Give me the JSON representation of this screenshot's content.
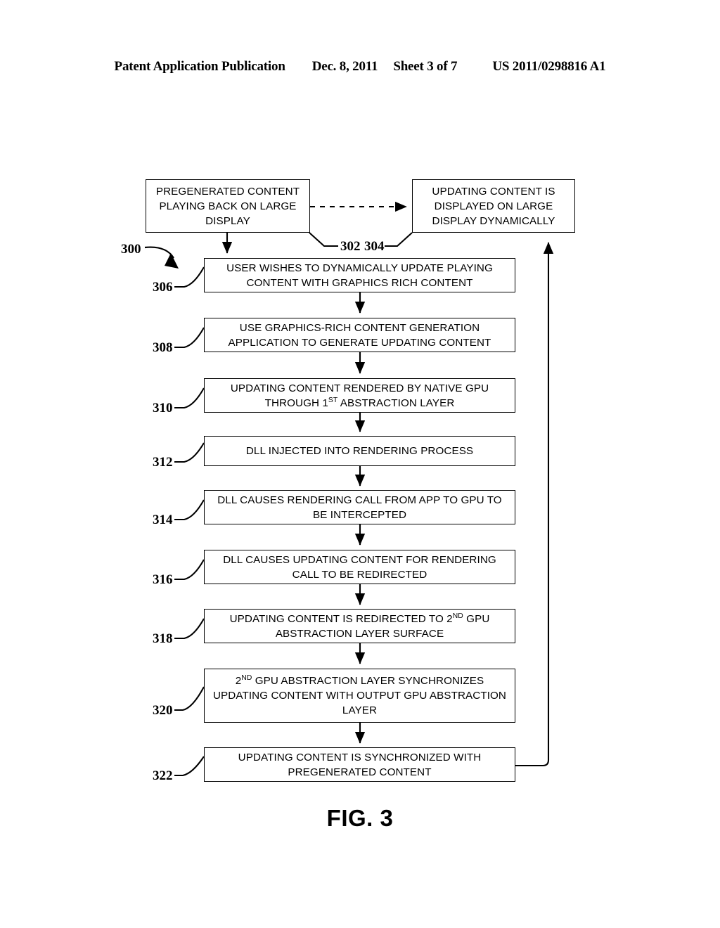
{
  "header": {
    "publication": "Patent Application Publication",
    "date": "Dec. 8, 2011",
    "sheet": "Sheet 3 of 7",
    "number": "US 2011/0298816 A1"
  },
  "figure": {
    "caption": "FIG. 3",
    "diagram_ref": "300"
  },
  "flowchart": {
    "nodes": [
      {
        "ref": "302",
        "name": "pregenerated-content-box",
        "lines": [
          "PREGENERATED CONTENT",
          "PLAYING BACK ON LARGE",
          "DISPLAY"
        ],
        "text": "PREGENERATED CONTENT PLAYING BACK ON LARGE DISPLAY"
      },
      {
        "ref": "304",
        "name": "updating-content-displayed-box",
        "lines": [
          "UPDATING CONTENT IS",
          "DISPLAYED ON LARGE",
          "DISPLAY DYNAMICALLY"
        ],
        "text": "UPDATING CONTENT IS DISPLAYED ON LARGE DISPLAY DYNAMICALLY"
      },
      {
        "ref": "306",
        "name": "user-wishes-update-box",
        "lines": [
          "USER WISHES TO DYNAMICALLY UPDATE PLAYING",
          "CONTENT WITH GRAPHICS RICH CONTENT"
        ],
        "text": "USER WISHES TO DYNAMICALLY UPDATE PLAYING CONTENT WITH GRAPHICS RICH CONTENT"
      },
      {
        "ref": "308",
        "name": "use-graphics-rich-application-box",
        "lines": [
          "USE GRAPHICS-RICH CONTENT GENERATION",
          "APPLICATION TO GENERATE UPDATING CONTENT"
        ],
        "text": "USE GRAPHICS-RICH CONTENT GENERATION APPLICATION TO GENERATE UPDATING CONTENT"
      },
      {
        "ref": "310",
        "name": "rendered-by-native-gpu-box",
        "lines": [
          "UPDATING CONTENT RENDERED BY NATIVE GPU",
          "THROUGH 1ST ABSTRACTION LAYER"
        ],
        "text": "UPDATING CONTENT RENDERED BY NATIVE GPU THROUGH 1ST ABSTRACTION LAYER"
      },
      {
        "ref": "312",
        "name": "dll-injected-box",
        "lines": [
          "DLL INJECTED INTO RENDERING PROCESS"
        ],
        "text": "DLL INJECTED INTO RENDERING PROCESS"
      },
      {
        "ref": "314",
        "name": "dll-intercepts-call-box",
        "lines": [
          "DLL CAUSES RENDERING CALL FROM APP TO GPU TO",
          "BE INTERCEPTED"
        ],
        "text": "DLL CAUSES RENDERING CALL FROM APP TO GPU TO BE INTERCEPTED"
      },
      {
        "ref": "316",
        "name": "dll-redirects-content-box",
        "lines": [
          "DLL CAUSES UPDATING CONTENT FOR RENDERING",
          "CALL TO BE REDIRECTED"
        ],
        "text": "DLL CAUSES UPDATING CONTENT FOR RENDERING CALL TO BE REDIRECTED"
      },
      {
        "ref": "318",
        "name": "redirected-to-2nd-gpu-surface-box",
        "lines": [
          "UPDATING CONTENT IS REDIRECTED TO 2ND GPU",
          "ABSTRACTION LAYER SURFACE"
        ],
        "text": "UPDATING CONTENT IS REDIRECTED TO 2ND GPU ABSTRACTION LAYER SURFACE"
      },
      {
        "ref": "320",
        "name": "2nd-gpu-synchronizes-box",
        "lines": [
          "2ND GPU ABSTRACTION LAYER SYNCHRONIZES",
          "UPDATING CONTENT WITH OUTPUT GPU",
          "ABSTRACTION LAYER"
        ],
        "text": "2ND GPU ABSTRACTION LAYER SYNCHRONIZES UPDATING CONTENT WITH OUTPUT GPU ABSTRACTION LAYER"
      },
      {
        "ref": "322",
        "name": "content-synchronized-box",
        "lines": [
          "UPDATING CONTENT IS SYNCHRONIZED WITH",
          "PREGENERATED CONTENT"
        ],
        "text": "UPDATING CONTENT IS SYNCHRONIZED WITH PREGENERATED CONTENT"
      }
    ],
    "connectors": [
      {
        "name": "dashed-arrow-302-to-304",
        "style": "dashed",
        "from": "302",
        "to": "304"
      },
      {
        "name": "arrow-302-to-306",
        "style": "solid",
        "from": "302",
        "to": "306"
      },
      {
        "name": "arrow-306-to-308",
        "style": "solid",
        "from": "306",
        "to": "308"
      },
      {
        "name": "arrow-308-to-310",
        "style": "solid",
        "from": "308",
        "to": "310"
      },
      {
        "name": "arrow-310-to-312",
        "style": "solid",
        "from": "310",
        "to": "312"
      },
      {
        "name": "arrow-312-to-314",
        "style": "solid",
        "from": "312",
        "to": "314"
      },
      {
        "name": "arrow-314-to-316",
        "style": "solid",
        "from": "314",
        "to": "316"
      },
      {
        "name": "arrow-316-to-318",
        "style": "solid",
        "from": "316",
        "to": "318"
      },
      {
        "name": "arrow-318-to-320",
        "style": "solid",
        "from": "318",
        "to": "320"
      },
      {
        "name": "arrow-320-to-322",
        "style": "solid",
        "from": "320",
        "to": "322"
      },
      {
        "name": "feedback-arrow-322-to-304",
        "style": "solid",
        "from": "322",
        "to": "304"
      }
    ]
  }
}
